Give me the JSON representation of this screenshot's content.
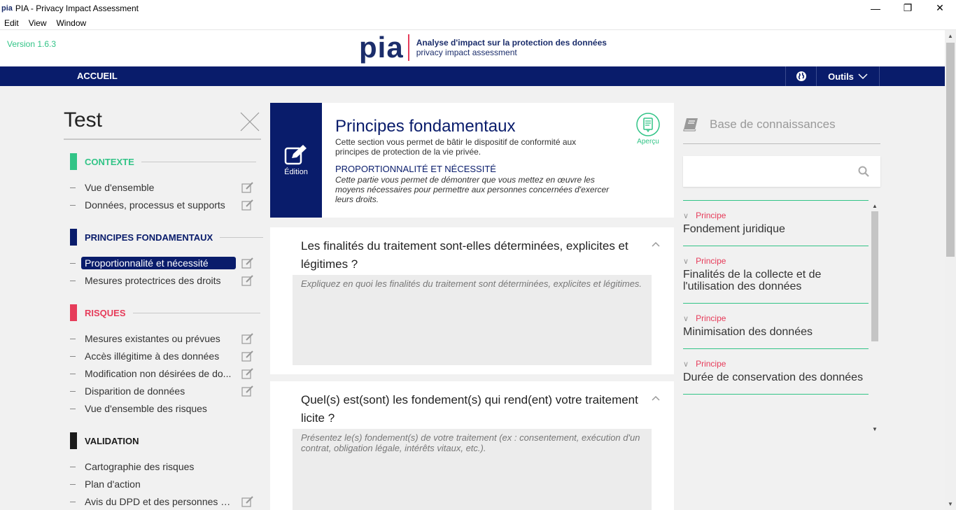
{
  "window": {
    "app_icon": "pia",
    "title": "PIA - Privacy Impact Assessment",
    "controls": [
      "—",
      "❐",
      "✕"
    ]
  },
  "menu": [
    "Edit",
    "View",
    "Window"
  ],
  "header": {
    "version": "Version 1.6.3",
    "logo_mark": "pia",
    "logo_line1": "Analyse d'impact sur la protection des données",
    "logo_line2": "privacy impact assessment"
  },
  "nav": {
    "home": "ACCUEIL",
    "tools": "Outils"
  },
  "sidebar": {
    "title": "Test",
    "sections": [
      {
        "label": "CONTEXTE",
        "color": "#32c487"
      },
      {
        "label": "PRINCIPES FONDAMENTAUX",
        "color": "#091c6b"
      },
      {
        "label": "RISQUES",
        "color": "#e63c5a"
      },
      {
        "label": "VALIDATION",
        "color": "#1b1b1b"
      }
    ],
    "items": [
      "Vue d'ensemble",
      "Données, processus et supports",
      "Proportionnalité et nécessité",
      "Mesures protectrices des droits",
      "Mesures existantes ou prévues",
      "Accès illégitime à des données",
      "Modification non désirées de do...",
      "Disparition de données",
      "Vue d'ensemble des risques",
      "Cartographie des risques",
      "Plan d'action",
      "Avis du DPD et des personnes c..."
    ]
  },
  "main": {
    "edition_label": "Édition",
    "title": "Principes fondamentaux",
    "description": "Cette section vous permet de bâtir le dispositif de conformité aux principes de protection de la vie privée.",
    "subtitle": "PROPORTIONNALITÉ ET NÉCESSITÉ",
    "subdescription": "Cette partie vous permet de démontrer que vous mettez en œuvre les moyens nécessaires pour permettre aux personnes concernées d'exercer leurs droits.",
    "apercu_label": "Aperçu",
    "questions": [
      {
        "question": "Les finalités du traitement sont-elles déterminées, explicites et légitimes ?",
        "placeholder": "Expliquez en quoi les finalités du traitement sont déterminées, explicites et légitimes."
      },
      {
        "question": "Quel(s) est(sont) les fondement(s) qui rend(ent) votre traitement licite ?",
        "placeholder": "Présentez le(s) fondement(s) de votre traitement (ex : consentement, exécution d'un contrat, obligation légale, intérêts vitaux, etc.)."
      }
    ]
  },
  "knowledge": {
    "title": "Base de connaissances",
    "items": [
      {
        "category": "Principe",
        "name": "Fondement juridique"
      },
      {
        "category": "Principe",
        "name": "Finalités de la collecte et de l'utilisation des données"
      },
      {
        "category": "Principe",
        "name": "Minimisation des données"
      },
      {
        "category": "Principe",
        "name": "Durée de conservation des données"
      }
    ]
  }
}
